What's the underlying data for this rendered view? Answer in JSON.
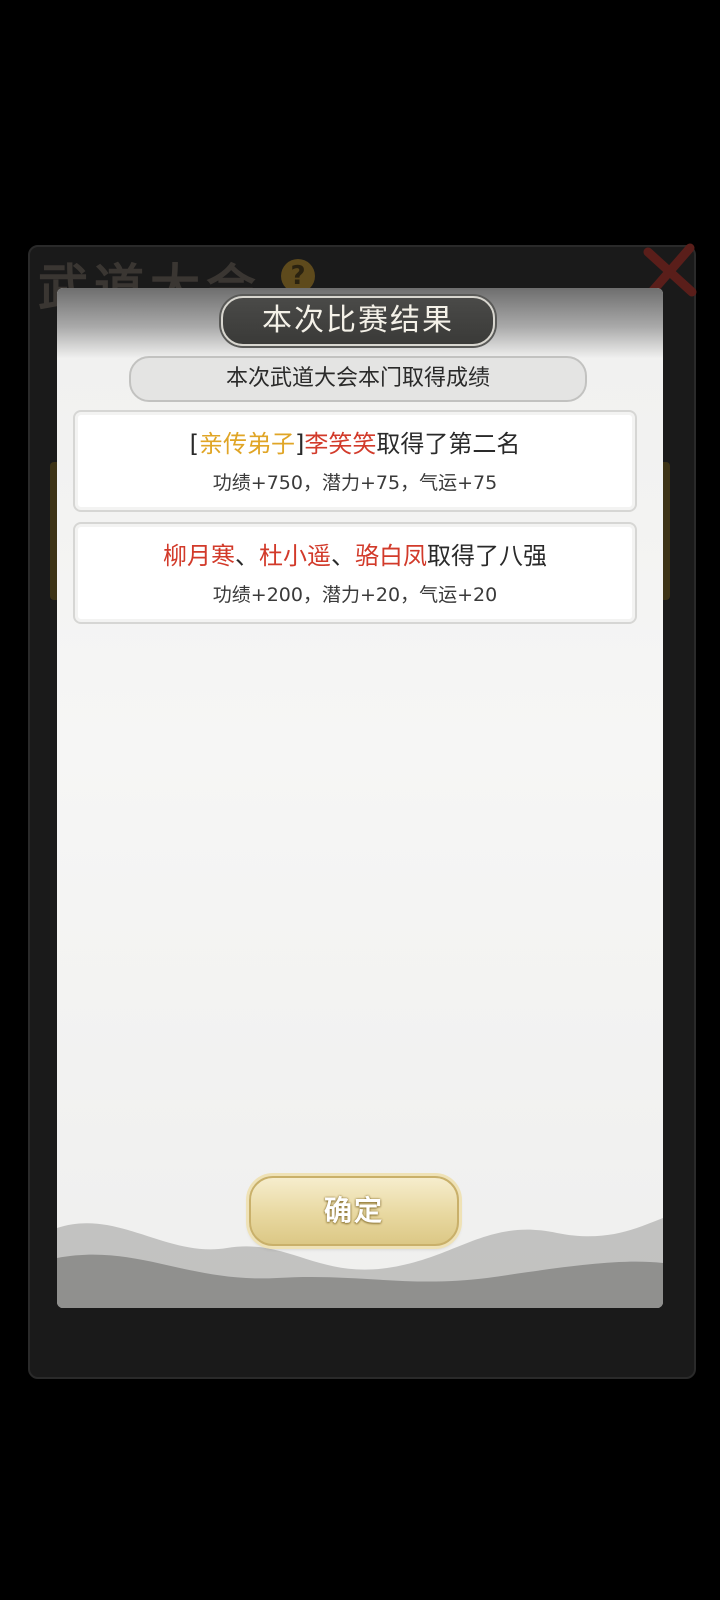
{
  "background_window": {
    "title": "武道大会",
    "help_icon": "?",
    "close_icon": "close-icon"
  },
  "modal": {
    "title": "本次比赛结果",
    "subtitle": "本次武道大会本门取得成绩",
    "results": [
      {
        "segments": [
          {
            "text": "[",
            "color": "#2a2a2a"
          },
          {
            "text": "亲传弟子",
            "color": "#e0a526"
          },
          {
            "text": "]",
            "color": "#2a2a2a"
          },
          {
            "text": "李笑笑",
            "color": "#d23a2a"
          },
          {
            "text": "取得了第二名",
            "color": "#2a2a2a"
          }
        ],
        "rewards": "功绩+750，潜力+75，气运+75"
      },
      {
        "segments": [
          {
            "text": "柳月寒",
            "color": "#d23a2a"
          },
          {
            "text": "、",
            "color": "#2a2a2a"
          },
          {
            "text": "杜小遥",
            "color": "#d23a2a"
          },
          {
            "text": "、",
            "color": "#2a2a2a"
          },
          {
            "text": "骆白凤",
            "color": "#d23a2a"
          },
          {
            "text": "取得了八强",
            "color": "#2a2a2a"
          }
        ],
        "rewards": "功绩+200，潜力+20，气运+20"
      }
    ],
    "confirm_label": "确定"
  }
}
